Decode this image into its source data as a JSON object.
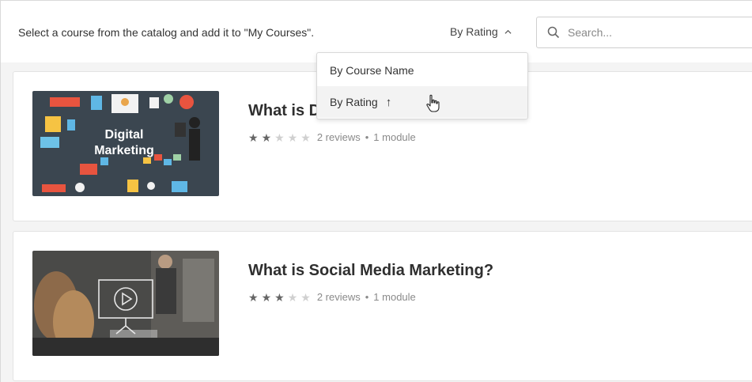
{
  "header": {
    "intro_text": "Select a course from the catalog and add it to \"My Courses\".",
    "sort_label": "By Rating",
    "search": {
      "placeholder": "Search...",
      "value": ""
    }
  },
  "sort_menu": {
    "open": true,
    "items": [
      {
        "label": "By Course Name",
        "icon": ""
      },
      {
        "label": "By Rating",
        "icon": "arrow-up-icon",
        "glyph": "↑",
        "hovered": true
      }
    ]
  },
  "courses": [
    {
      "title": "What is Digital Marketing?",
      "rating": 2,
      "max_rating": 5,
      "reviews": "2 reviews",
      "modules": "1 module",
      "thumbnail_text_line1": "Digital",
      "thumbnail_text_line2": "Marketing"
    },
    {
      "title": "What is Social Media Marketing?",
      "rating": 3,
      "max_rating": 5,
      "reviews": "2 reviews",
      "modules": "1 module",
      "thumbnail_icon": "play-video-icon"
    }
  ],
  "colors": {
    "page_bg": "#f4f4f4",
    "card_bg": "#ffffff",
    "thumb1_bg": "#3b4650",
    "star_on": "#666666",
    "star_off": "#d0d0d0"
  }
}
